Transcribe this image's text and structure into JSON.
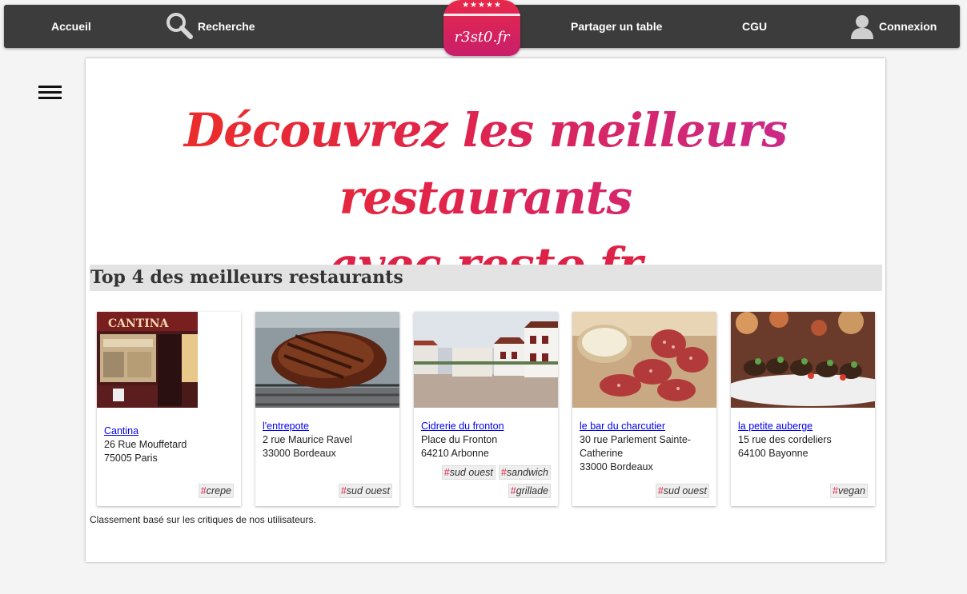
{
  "nav": {
    "home": "Accueil",
    "search": "Recherche",
    "share": "Partager un table",
    "terms": "CGU",
    "login": "Connexion"
  },
  "logo": {
    "stars": "★★★★★",
    "name": "r3st0.fr"
  },
  "hero": {
    "line1": "Découvrez les meilleurs restaurants",
    "line2": "avec resto.fr"
  },
  "section_title": "Top 4 des meilleurs restaurants",
  "tag_prefix": "#",
  "restaurants": [
    {
      "name": "Cantina",
      "address": "26 Rue Mouffetard",
      "city": "75005 Paris",
      "tags": [
        "crepe"
      ],
      "image": "storefront"
    },
    {
      "name": "l'entrepote",
      "address": "2 rue Maurice Ravel",
      "city": "33000 Bordeaux",
      "tags": [
        "sud ouest"
      ],
      "image": "grilled-steak"
    },
    {
      "name": "Cidrerie du fronton",
      "address": "Place du Fronton",
      "city": "64210 Arbonne",
      "tags": [
        "sud ouest",
        "sandwich",
        "grillade"
      ],
      "image": "village-square"
    },
    {
      "name": "le bar du charcutier",
      "address": "30 rue Parlement Sainte-Catherine",
      "city": "33000 Bordeaux",
      "tags": [
        "sud ouest"
      ],
      "image": "sausage-slices"
    },
    {
      "name": "la petite auberge",
      "address": "15 rue des cordeliers",
      "city": "64100 Bayonne",
      "tags": [
        "vegan"
      ],
      "image": "skewers-plate"
    }
  ],
  "footnote": "Classement basé sur les critiques de nos utilisateurs.",
  "colors": {
    "accent": "#e0244a",
    "nav_bg": "#3c3c3c"
  }
}
